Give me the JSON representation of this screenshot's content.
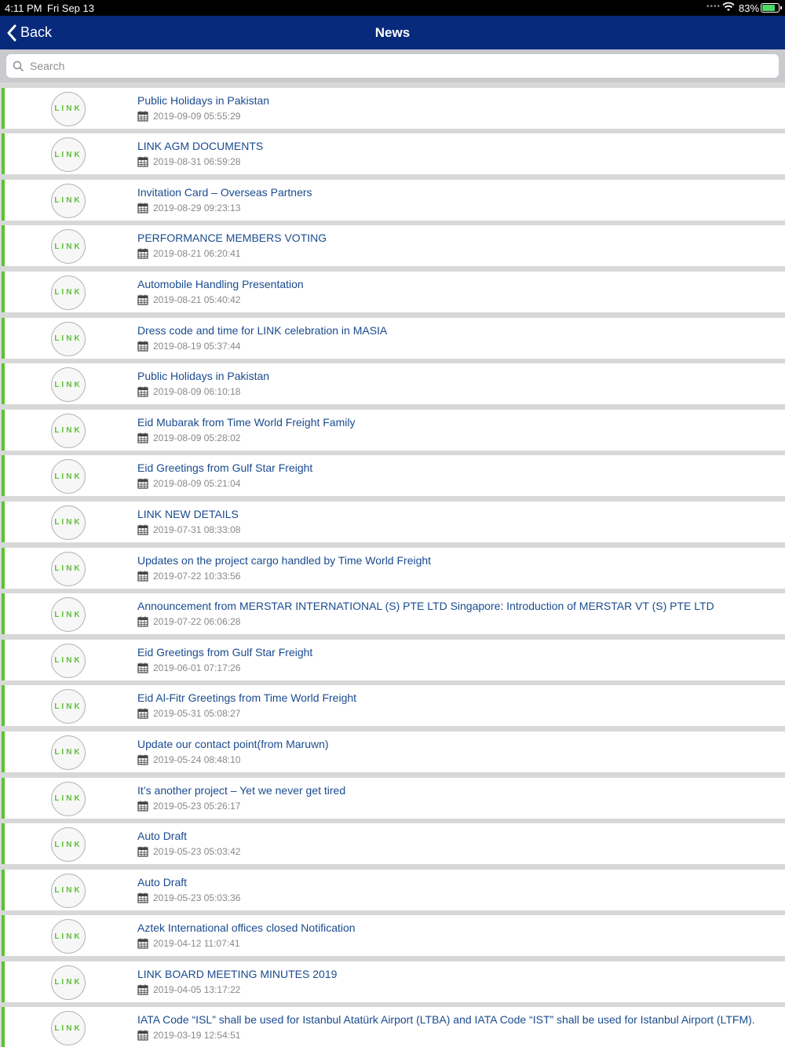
{
  "status_bar": {
    "time": "4:11 PM",
    "date": "Fri Sep 13",
    "battery": "83%"
  },
  "navbar": {
    "back_label": "Back",
    "title": "News"
  },
  "search": {
    "placeholder": "Search"
  },
  "logo_text": "LINK",
  "news": [
    {
      "title": "Public Holidays in Pakistan",
      "date": "2019-09-09 05:55:29"
    },
    {
      "title": "LINK AGM DOCUMENTS",
      "date": "2019-08-31 06:59:28"
    },
    {
      "title": "Invitation Card – Overseas Partners",
      "date": "2019-08-29 09:23:13"
    },
    {
      "title": "PERFORMANCE MEMBERS VOTING",
      "date": "2019-08-21 06:20:41"
    },
    {
      "title": "Automobile Handling Presentation",
      "date": "2019-08-21 05:40:42"
    },
    {
      "title": "Dress code and time for LINK celebration in MASIA",
      "date": "2019-08-19 05:37:44"
    },
    {
      "title": "Public Holidays in Pakistan",
      "date": "2019-08-09 06:10:18"
    },
    {
      "title": "Eid Mubarak from Time World Freight Family",
      "date": "2019-08-09 05:28:02"
    },
    {
      "title": "Eid Greetings from Gulf Star Freight",
      "date": "2019-08-09 05:21:04"
    },
    {
      "title": "LINK NEW DETAILS",
      "date": "2019-07-31 08:33:08"
    },
    {
      "title": "Updates on the project cargo handled by Time World Freight",
      "date": "2019-07-22 10:33:56"
    },
    {
      "title": "Announcement from MERSTAR INTERNATIONAL (S) PTE LTD Singapore: Introduction of MERSTAR VT (S) PTE LTD",
      "date": "2019-07-22 06:06:28"
    },
    {
      "title": "Eid Greetings from Gulf Star Freight",
      "date": "2019-06-01 07:17:26"
    },
    {
      "title": "Eid Al-Fitr Greetings from Time World Freight",
      "date": "2019-05-31 05:08:27"
    },
    {
      "title": "Update our contact point(from Maruwn)",
      "date": "2019-05-24 08:48:10"
    },
    {
      "title": "It’s another project – Yet we never get tired",
      "date": "2019-05-23 05:26:17"
    },
    {
      "title": "Auto Draft",
      "date": "2019-05-23 05:03:42"
    },
    {
      "title": "Auto Draft",
      "date": "2019-05-23 05:03:36"
    },
    {
      "title": "Aztek International offices closed Notification",
      "date": "2019-04-12 11:07:41"
    },
    {
      "title": "LINK BOARD MEETING MINUTES 2019",
      "date": "2019-04-05 13:17:22"
    },
    {
      "title": "IATA Code “ISL” shall be used for Istanbul Atatürk Airport (LTBA) and IATA Code “IST” shall be used for Istanbul Airport (LTFM).",
      "date": "2019-03-19 12:54:51"
    }
  ]
}
